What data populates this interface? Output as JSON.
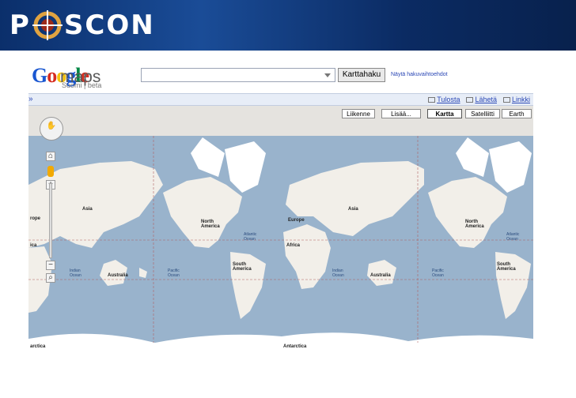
{
  "banner": {
    "logo_left": "P",
    "logo_right": "SCON"
  },
  "google": {
    "logo_letters": [
      "G",
      "o",
      "o",
      "g",
      "l",
      "e"
    ],
    "logo_colors": [
      "#1a57d1",
      "#d62d20",
      "#f4c20d",
      "#1a57d1",
      "#008744",
      "#d62d20"
    ],
    "maps_word": "maps",
    "sub_text": "Suomi | beta",
    "search_value": "",
    "search_button": "Karttahaku",
    "advanced_link": "Näytä hakuvaihtoehdot"
  },
  "toolbar": {
    "chevron": "»",
    "print": "Tulosta",
    "send": "Lähetä",
    "link": "Linkki"
  },
  "map_modes": {
    "traffic": "Liikenne",
    "more": "Lisää...",
    "map": "Kartta",
    "satellite": "Satelliitti",
    "earth": "Earth"
  },
  "labels": {
    "asia1": "Asia",
    "europe1": "rope",
    "ica1": "ica",
    "indian1": "Indian\nOcean",
    "australia1": "Australia",
    "pacific1": "Pacific\nOcean",
    "north_am1": "North\nAmerica",
    "atlantic1": "Atlantic\nOcean",
    "south_am1": "South\nAmerica",
    "europe2": "Europe",
    "africa2": "Africa",
    "asia2": "Asia",
    "indian2": "Indian\nOcean",
    "australia2": "Australia",
    "pacific2": "Pacific\nOcean",
    "north_am2": "North\nAmerica",
    "atlantic2": "Atlantic\nOcean",
    "south_am2": "South\nAmerica",
    "antarctica1": "arctica",
    "antarctica2": "Antarctica"
  },
  "colors": {
    "ocean": "#99b3cc",
    "land": "#f2efe9",
    "ice": "#ffffff",
    "green": "#c9dcb2"
  }
}
